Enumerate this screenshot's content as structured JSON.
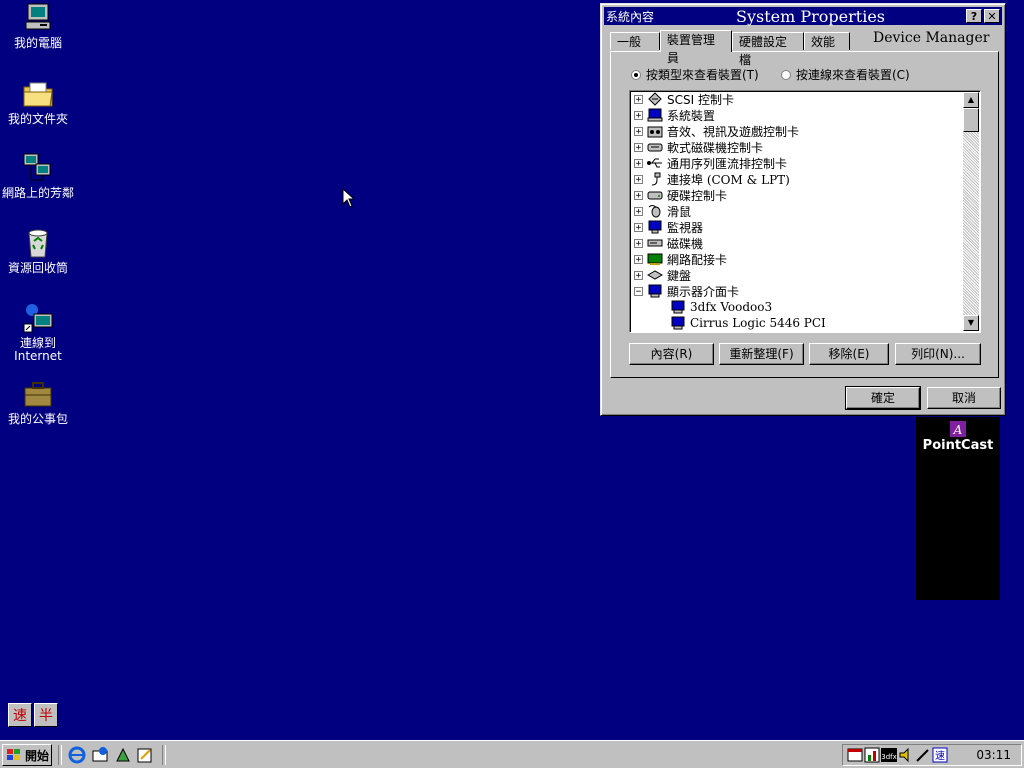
{
  "desktop": {
    "icons": [
      {
        "label": "我的電腦",
        "icon": "my-computer-icon"
      },
      {
        "label": "我的文件夾",
        "icon": "my-documents-icon"
      },
      {
        "label": "網路上的芳鄰",
        "icon": "network-neighborhood-icon"
      },
      {
        "label": "資源回收筒",
        "icon": "recycle-bin-icon"
      },
      {
        "label": "連線到",
        "label2": "Internet",
        "icon": "connect-internet-icon"
      },
      {
        "label": "我的公事包",
        "icon": "briefcase-icon"
      }
    ]
  },
  "window": {
    "title_small": "系統內容",
    "title_big": "System Properties",
    "help_label": "?",
    "close_label": "✕",
    "tabs": [
      "一般",
      "裝置管理員",
      "硬體設定檔",
      "效能"
    ],
    "heading": "Device Manager",
    "radio_type": "按類型來查看裝置(T)",
    "radio_connection": "按連線來查看裝置(C)",
    "tree": [
      {
        "label": "SCSI 控制卡",
        "expander": "+",
        "icon": "scsi-icon"
      },
      {
        "label": "系統裝置",
        "expander": "+",
        "icon": "system-device-icon"
      },
      {
        "label": "音效、視訊及遊戲控制卡",
        "expander": "+",
        "icon": "sound-icon"
      },
      {
        "label": "軟式磁碟機控制卡",
        "expander": "+",
        "icon": "floppy-controller-icon"
      },
      {
        "label": "通用序列匯流排控制卡",
        "expander": "+",
        "icon": "usb-icon"
      },
      {
        "label": "連接埠 (COM & LPT)",
        "expander": "+",
        "icon": "port-icon"
      },
      {
        "label": "硬碟控制卡",
        "expander": "+",
        "icon": "hdd-controller-icon"
      },
      {
        "label": "滑鼠",
        "expander": "+",
        "icon": "mouse-icon"
      },
      {
        "label": "監視器",
        "expander": "+",
        "icon": "monitor-icon"
      },
      {
        "label": "磁碟機",
        "expander": "+",
        "icon": "disk-drive-icon"
      },
      {
        "label": "網路配接卡",
        "expander": "+",
        "icon": "network-adapter-icon"
      },
      {
        "label": "鍵盤",
        "expander": "+",
        "icon": "keyboard-icon"
      },
      {
        "label": "顯示器介面卡",
        "expander": "−",
        "icon": "display-adapter-icon"
      },
      {
        "label": "3dfx Voodoo3",
        "child": true,
        "icon": "display-device-icon"
      },
      {
        "label": "Cirrus Logic 5446 PCI",
        "child": true,
        "icon": "display-device-icon"
      }
    ],
    "buttons": {
      "properties": "內容(R)",
      "refresh": "重新整理(F)",
      "remove": "移除(E)",
      "print": "列印(N)...",
      "ok": "確定",
      "cancel": "取消"
    }
  },
  "pointcast": {
    "logo": "PointCast"
  },
  "ime": {
    "left": "速",
    "right": "半"
  },
  "taskbar": {
    "start_label": "開始",
    "clock": "03:11"
  },
  "colors": {
    "desktop": "#000080",
    "face": "#c0c0c0",
    "title": "#000080"
  }
}
